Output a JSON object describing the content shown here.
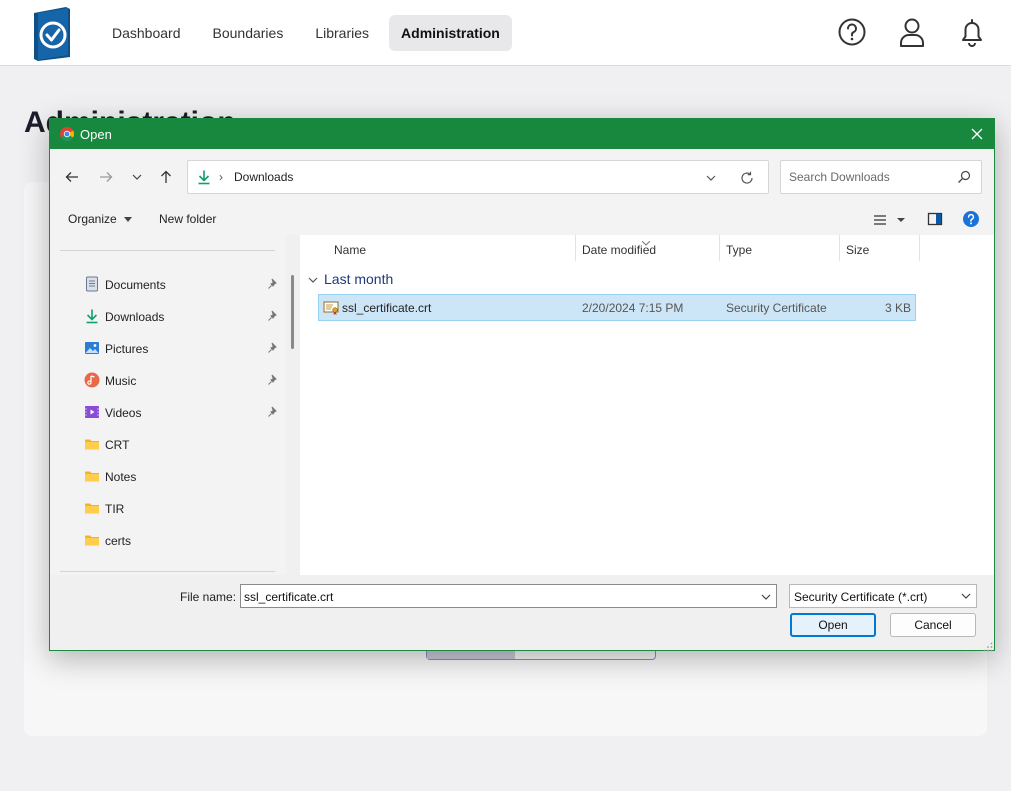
{
  "app": {
    "nav": [
      {
        "label": "Dashboard",
        "active": false
      },
      {
        "label": "Boundaries",
        "active": false
      },
      {
        "label": "Libraries",
        "active": false
      },
      {
        "label": "Administration",
        "active": true
      }
    ],
    "page_title": "Administration",
    "brand_color": "#1565a8"
  },
  "dialog": {
    "title": "Open",
    "titlebar_color": "#17883d",
    "address": {
      "crumb_separator": "›",
      "crumb": "Downloads"
    },
    "search": {
      "placeholder": "Search Downloads"
    },
    "toolbar": {
      "organize_label": "Organize",
      "new_folder_label": "New folder"
    },
    "sidebar": [
      {
        "label": "Documents",
        "icon": "documents-icon",
        "pinned": true
      },
      {
        "label": "Downloads",
        "icon": "downloads-icon",
        "pinned": true
      },
      {
        "label": "Pictures",
        "icon": "pictures-icon",
        "pinned": true
      },
      {
        "label": "Music",
        "icon": "music-icon",
        "pinned": true
      },
      {
        "label": "Videos",
        "icon": "videos-icon",
        "pinned": true
      },
      {
        "label": "CRT",
        "icon": "folder-icon",
        "pinned": false
      },
      {
        "label": "Notes",
        "icon": "folder-icon",
        "pinned": false
      },
      {
        "label": "TIR",
        "icon": "folder-icon",
        "pinned": false
      },
      {
        "label": "certs",
        "icon": "folder-icon",
        "pinned": false
      }
    ],
    "columns": {
      "name": "Name",
      "date": "Date modified",
      "type": "Type",
      "size": "Size"
    },
    "group": "Last month",
    "files": [
      {
        "name": "ssl_certificate.crt",
        "date": "2/20/2024 7:15 PM",
        "type": "Security Certificate",
        "size": "3 KB",
        "selected": true
      }
    ],
    "footer": {
      "file_name_label": "File name:",
      "file_name_value": "ssl_certificate.crt",
      "file_type": "Security Certificate (*.crt)",
      "open_label": "Open",
      "cancel_label": "Cancel"
    }
  }
}
